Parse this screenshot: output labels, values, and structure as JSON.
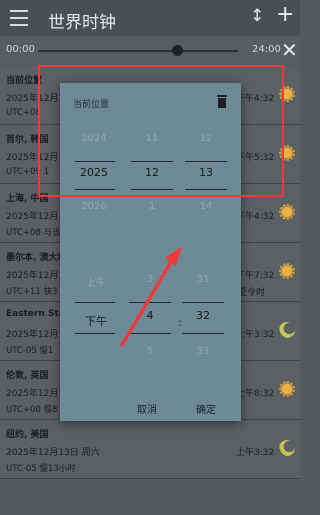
{
  "app": {
    "title": "世界时钟",
    "sort_icon": "↕",
    "add_icon": "+"
  },
  "timebar": {
    "start": "00:00",
    "end": "24:00",
    "slider_fraction": 0.72,
    "close_icon": "✕"
  },
  "clocks": [
    {
      "city": "当前位置",
      "date": "2025年12月1",
      "utc": "UTC+08",
      "time": "下午4:32",
      "dst": "",
      "icon": "sun"
    },
    {
      "city": "首尔, 韩国",
      "date": "2025年12月1",
      "utc": "UTC+09  1",
      "time": "下午5:32",
      "dst": "",
      "icon": "sun"
    },
    {
      "city": "上海, 中国",
      "date": "2025年12月1",
      "utc": "UTC+08  与当",
      "time": "下午4:32",
      "dst": "",
      "icon": "sun"
    },
    {
      "city": "墨尔本, 澳大利",
      "date": "2025年12月1",
      "utc": "UTC+11  快3",
      "time": "下午7:32",
      "dst": "夏令时",
      "icon": "sun"
    },
    {
      "city": "Eastern Stan",
      "date": "2025年12月1",
      "utc": "UTC-05  慢1",
      "time": "上午3:32",
      "dst": "",
      "icon": "moon"
    },
    {
      "city": "伦敦, 英国",
      "date": "2025年12月1",
      "utc": "UTC+00  慢8",
      "time": "上午8:32",
      "dst": "",
      "icon": "sun"
    },
    {
      "city": "纽约, 美国",
      "date": "2025年12月13日 周六",
      "utc": "UTC-05  慢13小时",
      "time": "上午3:32",
      "dst": "",
      "icon": "moon"
    }
  ],
  "dialog": {
    "title": "当前位置",
    "delete_icon": "trash-icon",
    "year": {
      "prev": "2024",
      "value": "2025",
      "next": "2026"
    },
    "month": {
      "prev": "11",
      "value": "12",
      "next": "1"
    },
    "day": {
      "prev": "12",
      "value": "13",
      "next": "14"
    },
    "ampm": {
      "prev": "上午",
      "value": "下午"
    },
    "hour": {
      "prev": "3",
      "value": "4",
      "next": "5"
    },
    "minute": {
      "prev": "31",
      "value": "32",
      "next": "33"
    },
    "colon": ":",
    "cancel": "取消",
    "ok": "确定"
  },
  "colors": {
    "highlight": "#ee3a3a",
    "dialog_bg": "#6e8a96"
  }
}
